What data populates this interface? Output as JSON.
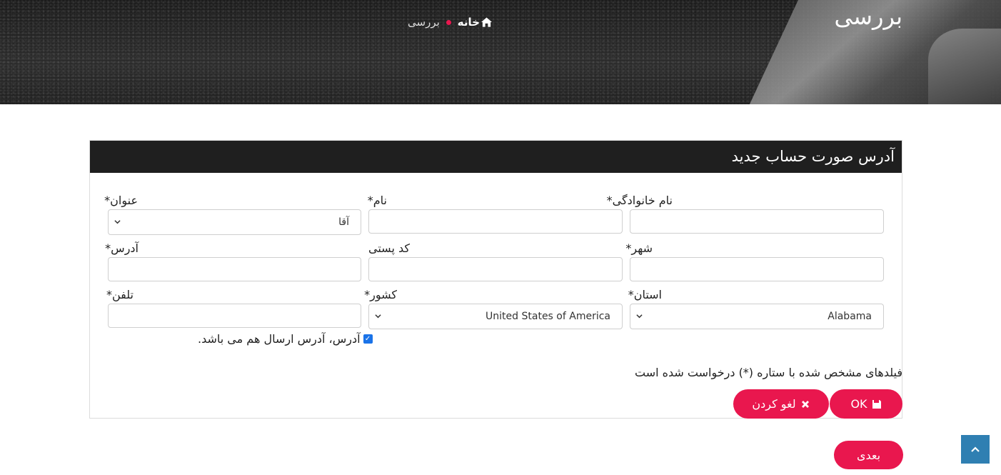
{
  "hero": {
    "title": "بررسی",
    "breadcrumb": {
      "home": "خانه",
      "current": "بررسی"
    }
  },
  "panel": {
    "title": "آدرس صورت حساب جدید"
  },
  "form": {
    "last_name_label": "نام خانوادگی*",
    "first_name_label": "نام*",
    "title_label": "عنوان*",
    "title_value": "آقا",
    "city_label": "شهر*",
    "postal_label": "کد پستی",
    "address_label": "آدرس*",
    "state_label": "استان*",
    "state_value": "Alabama",
    "country_label": "کشور*",
    "country_value": "United States of America",
    "phone_label": "تلفن*",
    "same_address_label": "آدرس، آدرس ارسال هم می باشد.",
    "same_address_checked": true,
    "required_note": "فیلدهای مشخص شده با ستاره (*) درخواست شده است"
  },
  "buttons": {
    "ok_label": "OK",
    "cancel_label": "لغو کردن",
    "next_label": "بعدی"
  },
  "colors": {
    "accent": "#e9174e",
    "header_dark": "#1f1f1f",
    "to_top": "#2f7fb2"
  },
  "icons": {
    "home": "home-icon",
    "save": "floppy-disk-icon",
    "cancel": "close-icon",
    "to_top": "chevron-up-icon",
    "select": "chevron-down-icon"
  }
}
